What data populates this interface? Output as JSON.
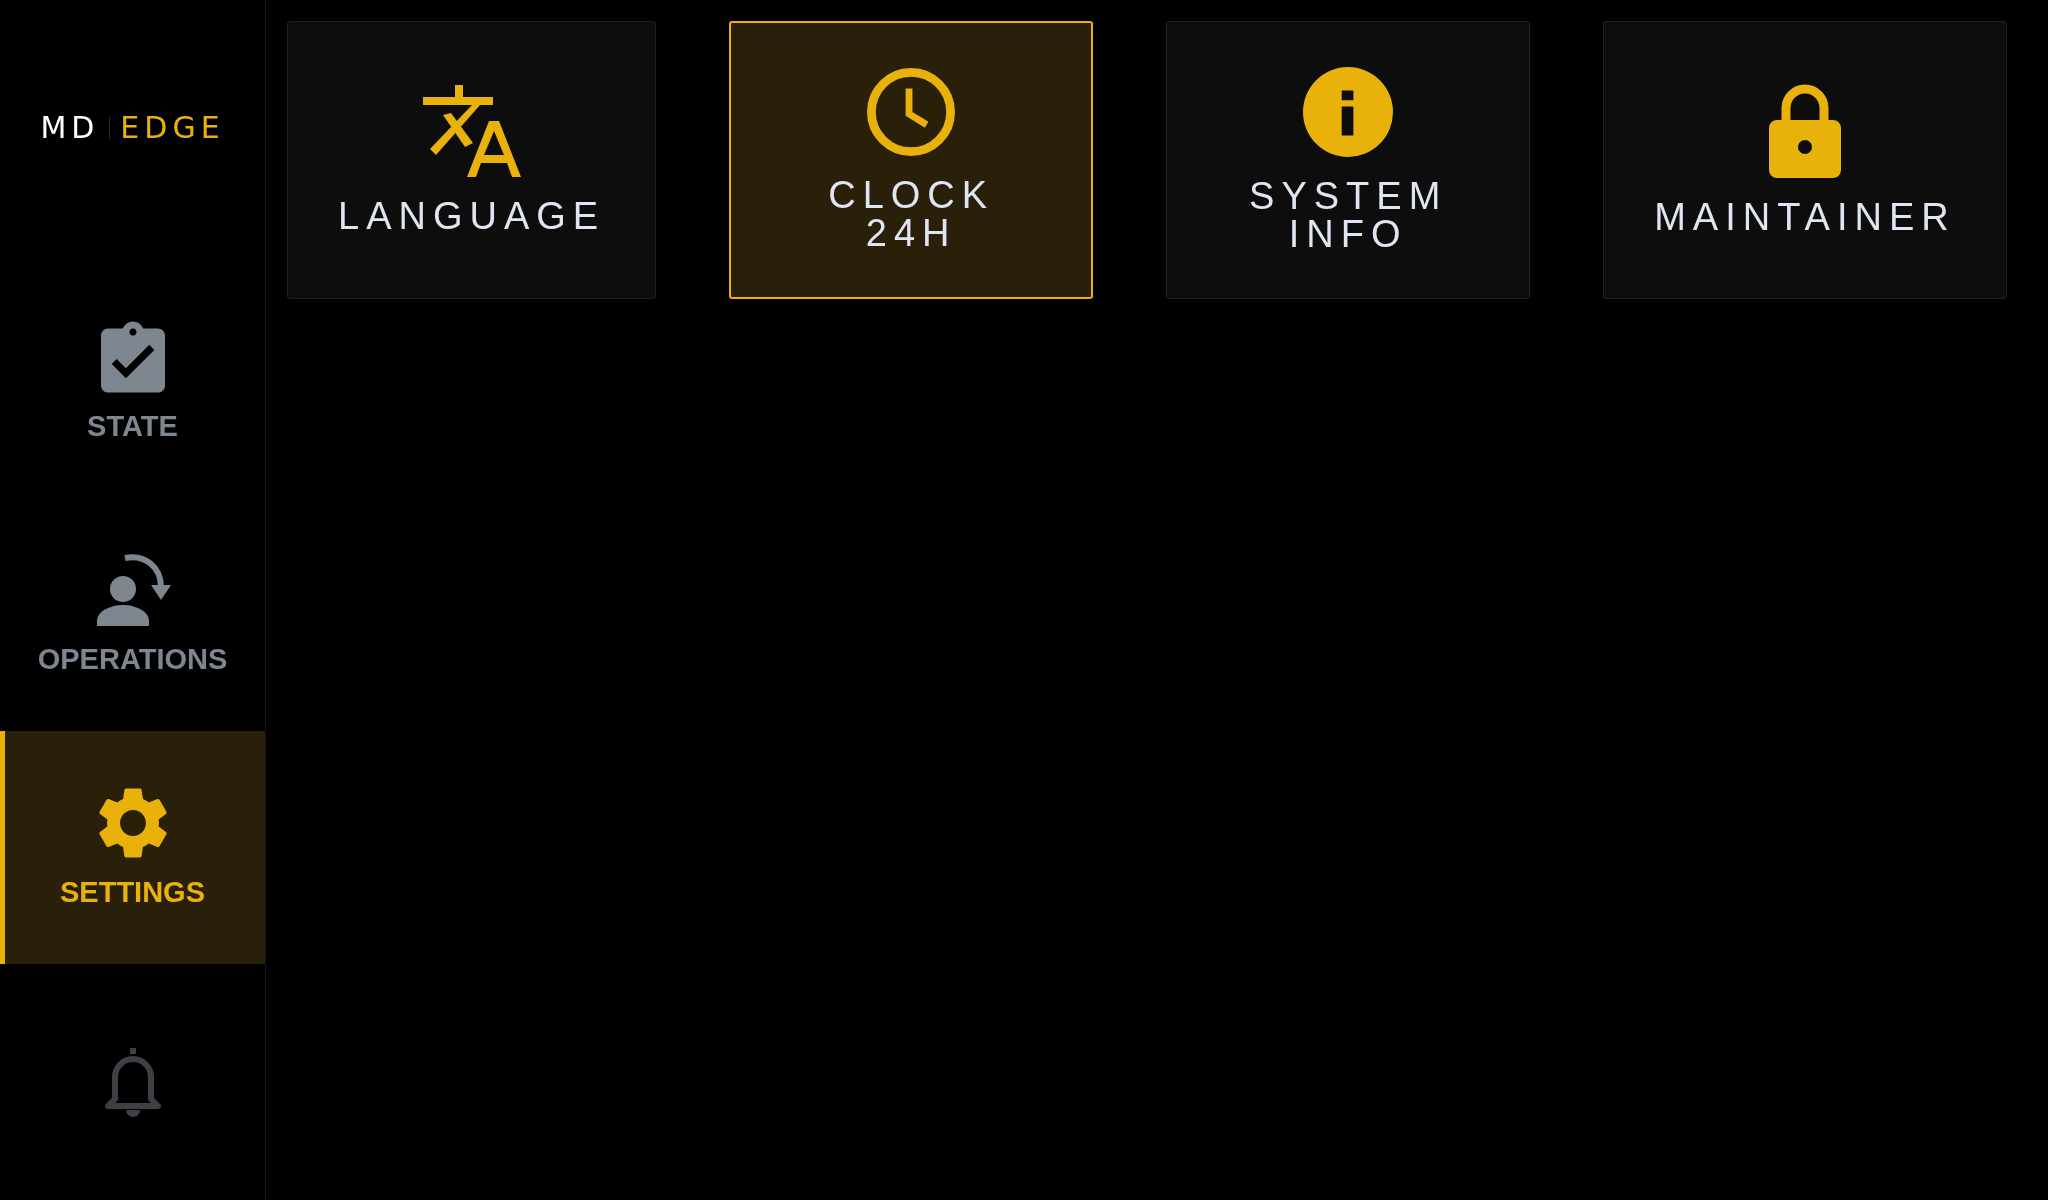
{
  "logo": {
    "prefix": "MD",
    "name": "EDGE"
  },
  "nav": [
    {
      "label": "STATE",
      "selected": false,
      "disabled": false
    },
    {
      "label": "OPERATIONS",
      "selected": false,
      "disabled": false
    },
    {
      "label": "SETTINGS",
      "selected": true,
      "disabled": false
    },
    {
      "selected": false,
      "disabled": true
    }
  ],
  "tiles": [
    {
      "label": "LANGUAGE",
      "selected": false
    },
    {
      "label": "CLOCK\n24H",
      "selected": true
    },
    {
      "label": "SYSTEM\nINFO",
      "selected": false
    },
    {
      "label": "MAINTAINER",
      "selected": false
    }
  ]
}
